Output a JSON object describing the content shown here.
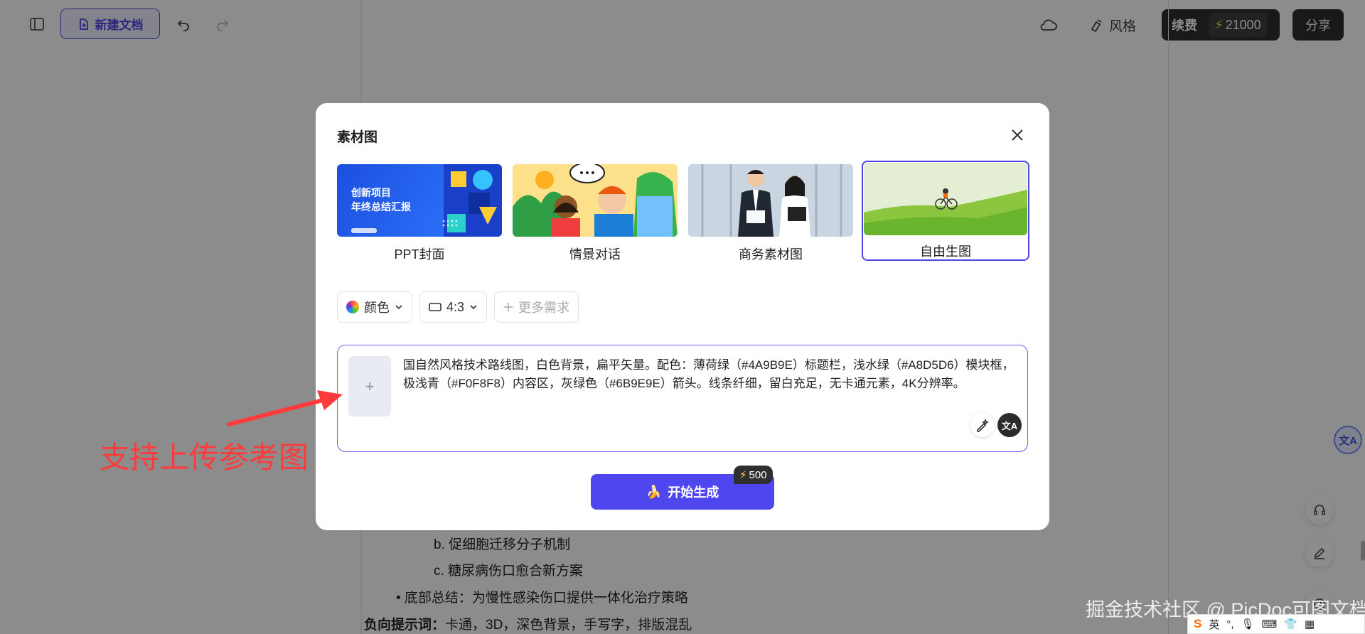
{
  "toolbar": {
    "new_doc_label": "新建文档",
    "style_label": "风格",
    "renew_label": "续费",
    "credits": "21000",
    "share_label": "分享"
  },
  "document": {
    "lines": [
      "b. 促细胞迁移分子机制",
      "c. 糖尿病伤口愈合新方案",
      "• 底部总结：为慢性感染伤口提供一体化治疗策略"
    ],
    "negative_label": "负向提示词：",
    "negative_value": "卡通，3D，深色背景，手写字，排版混乱"
  },
  "modal": {
    "title": "素材图",
    "templates": [
      {
        "label": "PPT封面",
        "thumb_title_1": "创新项目",
        "thumb_title_2": "年终总结汇报"
      },
      {
        "label": "情景对话"
      },
      {
        "label": "商务素材图"
      },
      {
        "label": "自由生图",
        "selected": true
      }
    ],
    "options": {
      "color_label": "颜色",
      "ratio_label": "4:3",
      "more_label": "更多需求"
    },
    "prompt": "国自然风格技术路线图，白色背景，扁平矢量。配色：薄荷绿（#4A9B9E）标题栏，浅水绿（#A8D5D6）模块框，极浅青（#F0F8F8）内容区，灰绿色（#6B9E9E）箭头。线条纤细，留白充足，无卡通元素，4K分辨率。",
    "generate_label": "开始生成",
    "cost": "500"
  },
  "annotation": {
    "text": "支持上传参考图"
  },
  "watermark": "掘金技术社区 @ PicDoc可图文档",
  "ime": {
    "lang": "英"
  },
  "colors": {
    "accent": "#4f46e5",
    "annotation": "#ff3b3b",
    "dark_button": "#2f2f2f"
  }
}
